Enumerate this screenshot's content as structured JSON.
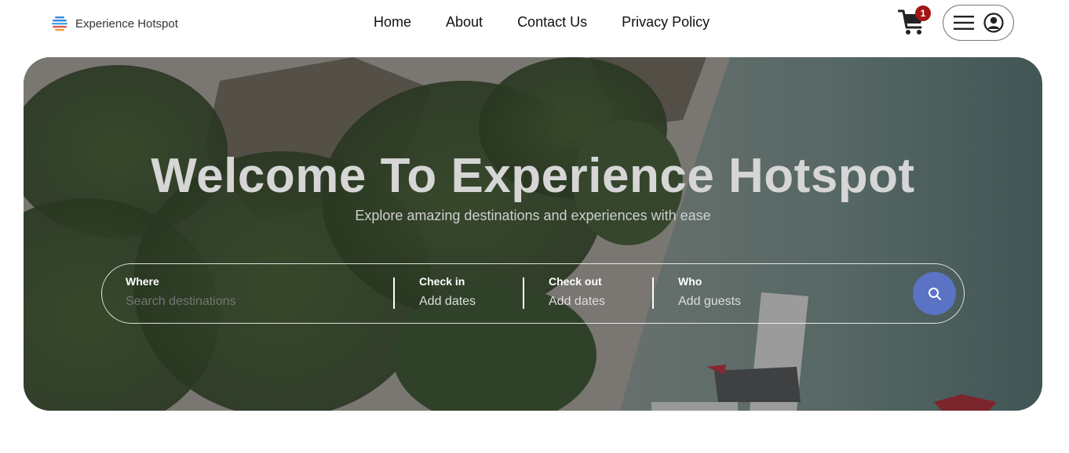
{
  "brand": {
    "name": "Experience Hotspot",
    "logo_icon": "globe-logo-icon"
  },
  "nav": {
    "links": [
      {
        "label": "Home"
      },
      {
        "label": "About"
      },
      {
        "label": "Contact Us"
      },
      {
        "label": "Privacy Policy"
      }
    ]
  },
  "cart": {
    "icon": "shopping-cart-icon",
    "count": "1",
    "badge_color": "#a31414"
  },
  "user_menu": {
    "menu_icon": "hamburger-menu-icon",
    "avatar_icon": "user-circle-icon"
  },
  "hero": {
    "title": "Welcome To Experience Hotspot",
    "subtitle": "Explore amazing destinations and experiences with ease",
    "background": "tropical beach with palm trees and seaplane (aerial view)"
  },
  "search": {
    "where": {
      "label": "Where",
      "placeholder": "Search destinations"
    },
    "check_in": {
      "label": "Check in",
      "value": "Add dates"
    },
    "check_out": {
      "label": "Check out",
      "value": "Add dates"
    },
    "who": {
      "label": "Who",
      "value": "Add guests"
    },
    "button_icon": "search-icon",
    "button_color": "#5a73c4"
  }
}
